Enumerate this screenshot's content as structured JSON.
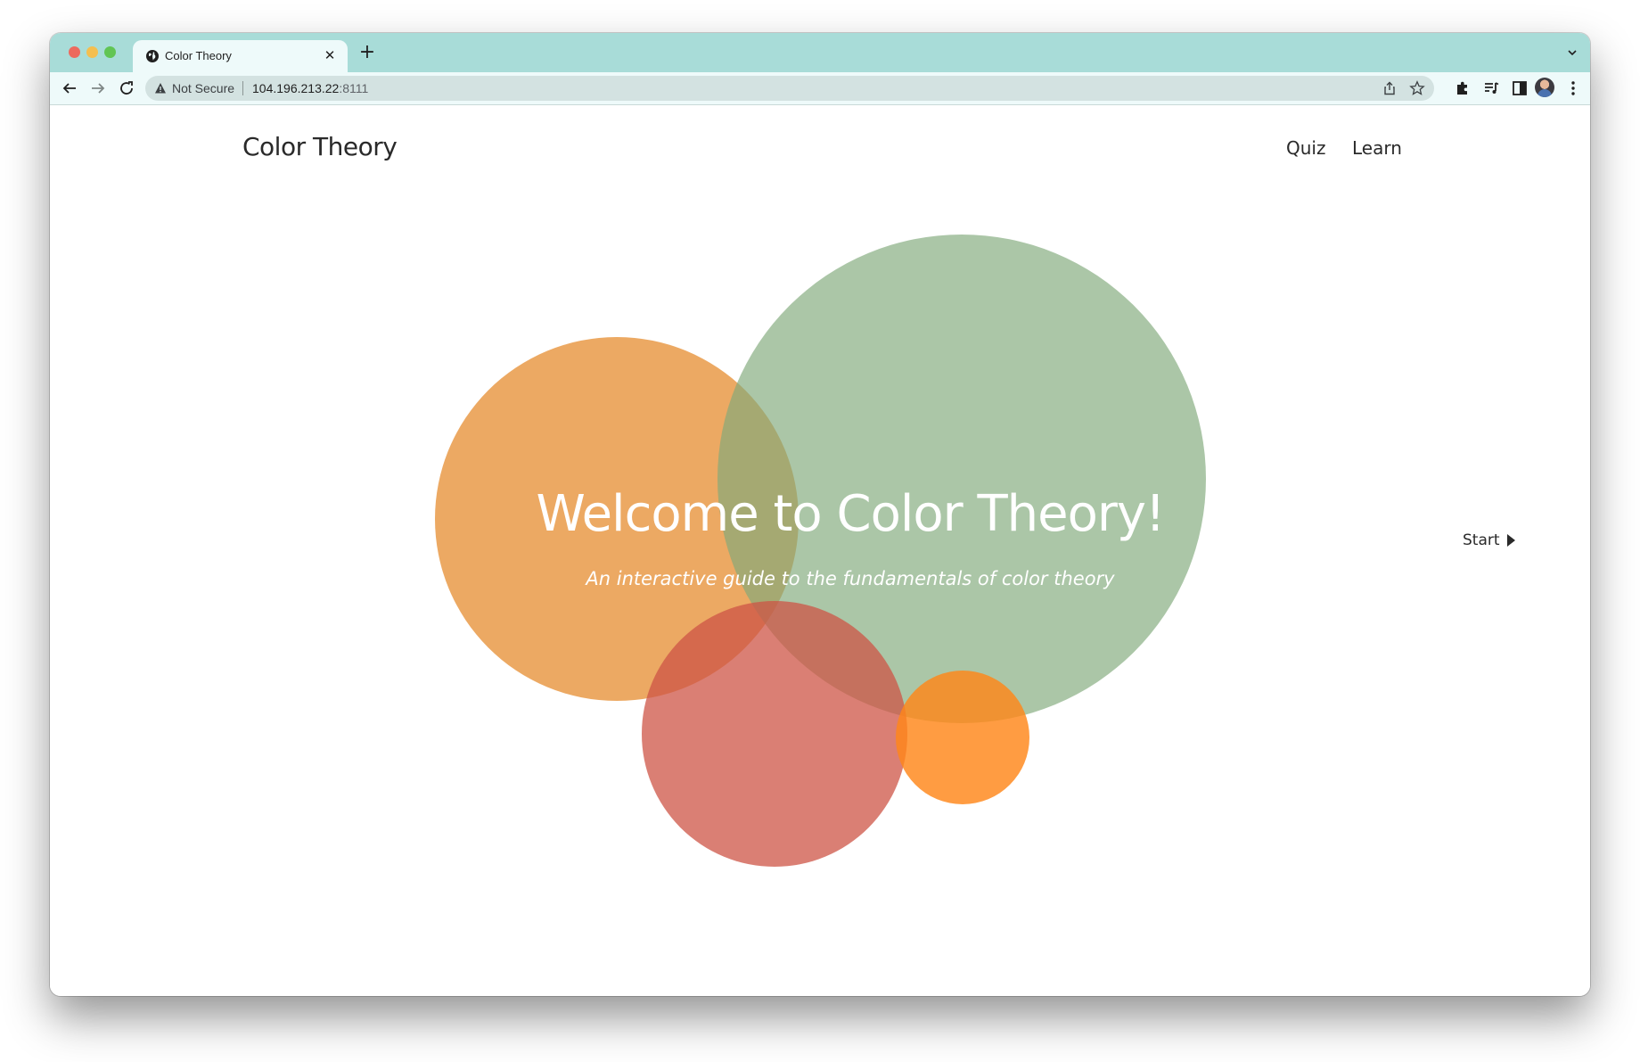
{
  "browser": {
    "tab": {
      "title": "Color Theory",
      "favicon": "globe-icon"
    },
    "address_bar": {
      "security_label": "Not Secure",
      "url_host": "104.196.213.22",
      "url_port": ":8111"
    },
    "colors": {
      "tabstrip": "#a8dcd8",
      "toolbar": "#eefafa",
      "omnibox": "#d3e2e1"
    }
  },
  "site": {
    "title": "Color Theory",
    "nav": {
      "quiz_label": "Quiz",
      "learn_label": "Learn"
    }
  },
  "hero": {
    "title": "Welcome to Color Theory!",
    "subtitle": "An interactive guide to the fundamentals of color theory",
    "start_label": "Start",
    "circle_colors": {
      "orange_large": "#eca665",
      "green_large": "#aac6a7",
      "red_medium": "#d87e74",
      "orange_small": "#fd9a3d"
    }
  }
}
